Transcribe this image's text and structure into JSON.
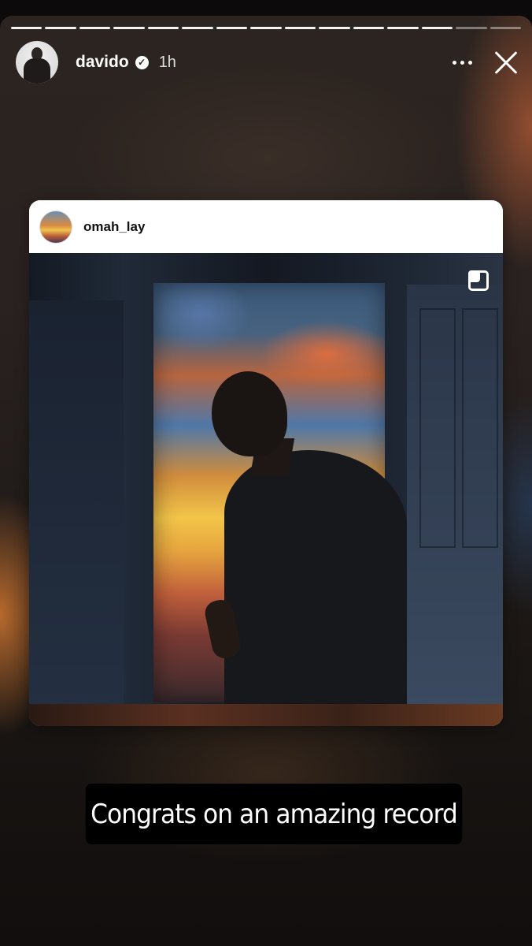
{
  "story": {
    "progress": {
      "total_segments": 15,
      "current_segment": 13
    },
    "user": {
      "name": "davido",
      "verified": true
    },
    "time_ago": "1h",
    "icons": {
      "more": "more-horizontal-icon",
      "close": "close-icon",
      "verified": "verified-badge-icon",
      "multiple": "carousel-multiple-icon"
    }
  },
  "shared_post": {
    "username": "omah_lay"
  },
  "caption": "Congrats on an amazing record"
}
